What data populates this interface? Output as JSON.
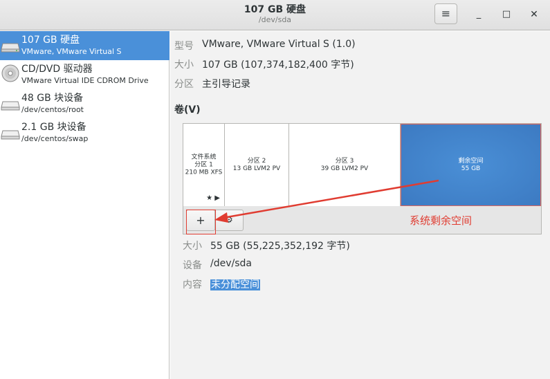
{
  "header": {
    "title": "107 GB 硬盘",
    "subtitle": "/dev/sda",
    "menu_icon": "hamburger-menu-icon",
    "minimize_glyph": "_",
    "maximize_glyph": "□",
    "close_glyph": "✕"
  },
  "sidebar": {
    "items": [
      {
        "name": "107 GB 硬盘",
        "desc": "VMware, VMware Virtual S",
        "icon": "harddisk-icon",
        "selected": true
      },
      {
        "name": "CD/DVD 驱动器",
        "desc": "VMware Virtual IDE CDROM Drive",
        "icon": "optical-drive-icon",
        "selected": false
      },
      {
        "name": "48 GB 块设备",
        "desc": "/dev/centos/root",
        "icon": "block-device-icon",
        "selected": false
      },
      {
        "name": "2.1 GB 块设备",
        "desc": "/dev/centos/swap",
        "icon": "block-device-icon",
        "selected": false
      }
    ]
  },
  "disk_info": {
    "model_label": "型号",
    "model_value": "VMware, VMware Virtual S (1.0)",
    "size_label": "大小",
    "size_value": "107 GB (107,374,182,400 字节)",
    "partitioning_label": "分区",
    "partitioning_value": "主引导记录"
  },
  "volumes": {
    "heading": "卷(V)",
    "partitions": [
      {
        "line1": "文件系统",
        "line2": "分区 1",
        "line3": "210 MB XFS"
      },
      {
        "line1": "分区 2",
        "line2": "13 GB LVM2 PV"
      },
      {
        "line1": "分区 3",
        "line2": "39 GB LVM2 PV"
      },
      {
        "line1": "剩余空间",
        "line2": "55 GB"
      }
    ],
    "partition1_icons": "★ ▶",
    "add_button": "+",
    "gear_button": "⚙"
  },
  "selected_volume": {
    "size_label": "大小",
    "size_value": "55 GB (55,225,352,192 字节)",
    "device_label": "设备",
    "device_value": "/dev/sda",
    "content_label": "内容",
    "content_value": "未分配空间"
  },
  "annotation": {
    "text": "系统剩余空间",
    "color": "#e03c31"
  },
  "colors": {
    "accent": "#4a90d9",
    "annotation": "#e03c31"
  }
}
